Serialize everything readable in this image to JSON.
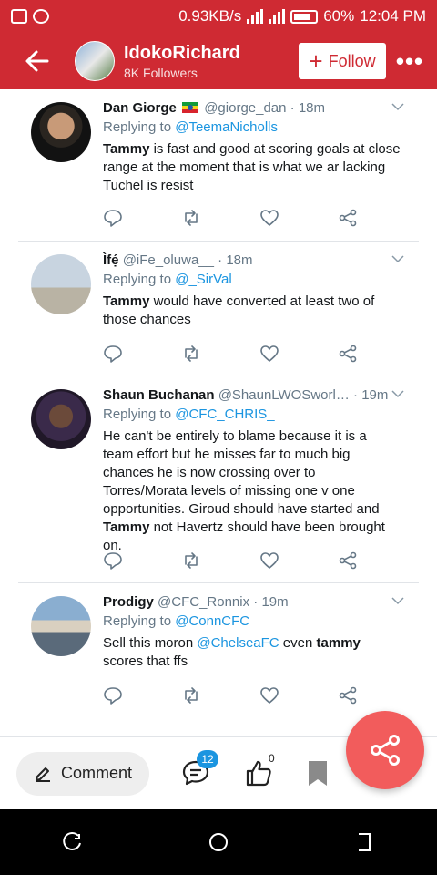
{
  "status_bar": {
    "speed": "0.93KB/s",
    "battery": "60%",
    "time": "12:04 PM"
  },
  "header": {
    "name": "IdokoRichard",
    "followers": "8K Followers",
    "follow_label": "Follow",
    "more_label": "•••"
  },
  "tweets": [
    {
      "author": "Dan Giorge",
      "handle": "@giorge_dan",
      "time": "· 18m",
      "replying_prefix": "Replying to",
      "replying_to": "@TeemaNicholls",
      "text_bold": "Tammy",
      "text_rest": " is fast and good at scoring goals at close range at the moment that is what we ar lacking Tuchel is resist"
    },
    {
      "author": "Ìfẹ́",
      "handle": "@iFe_oluwa__",
      "time": "· 18m",
      "replying_prefix": "Replying to",
      "replying_to": "@_SirVal",
      "text_bold": "Tammy",
      "text_rest": " would have converted at least two of those chances"
    },
    {
      "author": "Shaun Buchanan",
      "handle": "@ShaunLWOSworl…",
      "time": "· 19m",
      "replying_prefix": "Replying to",
      "replying_to": "@CFC_CHRIS_",
      "text_pre": "He can't be entirely to blame because it is a team effort but he misses far to much big chances he is now crossing over to Torres/Morata levels of missing one v one opportunities. Giroud should have started and ",
      "text_bold": "Tammy",
      "text_rest": " not Havertz should have been brought on."
    },
    {
      "author": "Prodigy",
      "handle": "@CFC_Ronnix",
      "time": "· 19m",
      "replying_prefix": "Replying to",
      "replying_to": "@ConnCFC",
      "text_pre": "Sell this moron ",
      "text_link": "@ChelseaFC",
      "text_mid": " even ",
      "text_bold": "tammy",
      "text_rest": " scores that ffs"
    }
  ],
  "bottom_bar": {
    "comment_label": "Comment",
    "comment_count": "12",
    "like_count": "0"
  },
  "colors": {
    "brand": "#cf2a33",
    "link": "#1b95e0",
    "fab": "#f25c5c"
  }
}
